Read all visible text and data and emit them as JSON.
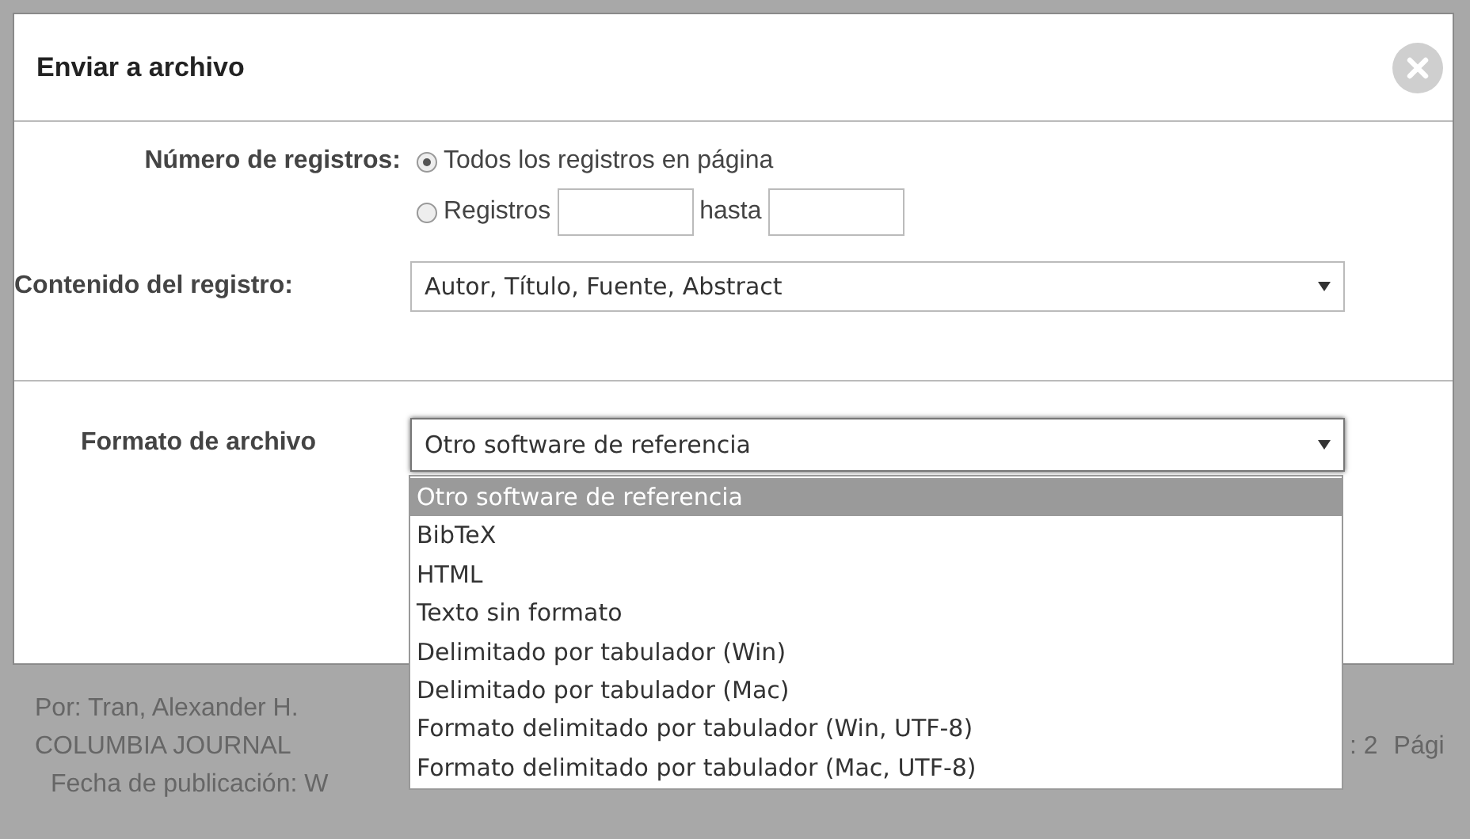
{
  "dialog": {
    "title": "Enviar a archivo",
    "records": {
      "label": "Número de registros:",
      "options": [
        {
          "kind": "all",
          "label": "Todos los registros en página",
          "selected": true
        },
        {
          "kind": "range",
          "label": "Registros",
          "to_label": "hasta",
          "selected": false
        }
      ]
    },
    "content": {
      "label": "Contenido del registro:",
      "value": "Autor, Título, Fuente, Abstract"
    },
    "format": {
      "label": "Formato de archivo",
      "value": "Otro software de referencia",
      "expanded": true,
      "options": [
        {
          "label": "Otro software de referencia",
          "selected": true
        },
        {
          "label": "BibTeX",
          "selected": false
        },
        {
          "label": "HTML",
          "selected": false
        },
        {
          "label": "Texto sin formato",
          "selected": false
        },
        {
          "label": "Delimitado por tabulador (Win)",
          "selected": false
        },
        {
          "label": "Delimitado por tabulador (Mac)",
          "selected": false
        },
        {
          "label": "Formato delimitado por tabulador (Win, UTF-8)",
          "selected": false
        },
        {
          "label": "Formato delimitado por tabulador (Mac, UTF-8)",
          "selected": false
        }
      ]
    }
  },
  "background": {
    "author": "Por: Tran, Alexander H.",
    "journal": "COLUMBIA JOURNAL",
    "pages": ": 2",
    "page_label": "Pági",
    "date": "Fecha de publicación: W"
  }
}
